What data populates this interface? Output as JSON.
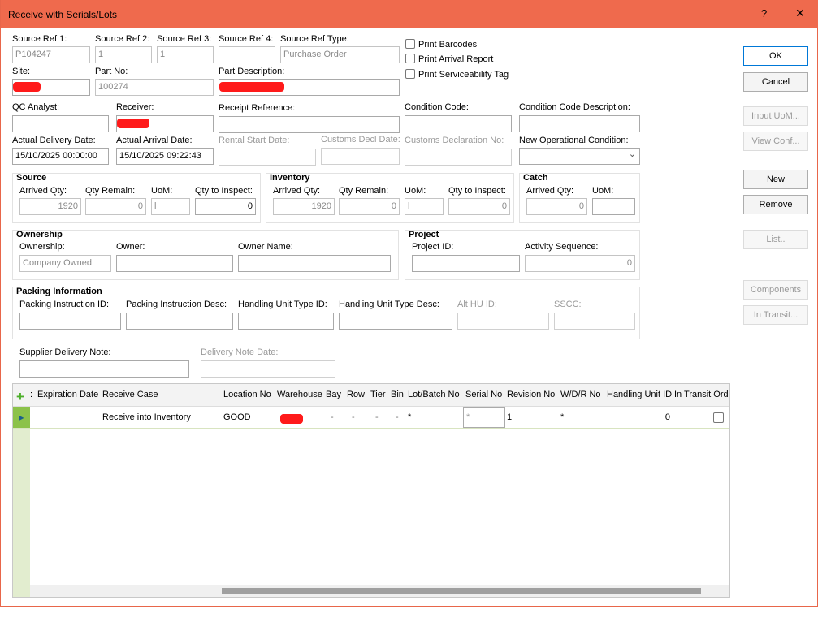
{
  "window": {
    "title": "Receive with Serials/Lots",
    "help": "?",
    "close": "✕"
  },
  "header": {
    "fields": [
      {
        "id": "src1",
        "label": "Source Ref 1:",
        "value": "P104247",
        "state": "readonly"
      },
      {
        "id": "src2",
        "label": "Source Ref 2:",
        "value": "1",
        "state": "readonly"
      },
      {
        "id": "src3",
        "label": "Source Ref 3:",
        "value": "1",
        "state": "readonly"
      },
      {
        "id": "src4",
        "label": "Source Ref 4:",
        "value": "",
        "state": "readonly"
      },
      {
        "id": "srctype",
        "label": "Source Ref Type:",
        "value": "Purchase Order",
        "state": "readonly"
      },
      {
        "id": "site",
        "label": "Site:",
        "value": "",
        "state": "redacted"
      },
      {
        "id": "partno",
        "label": "Part No:",
        "value": "100274",
        "state": "readonly"
      },
      {
        "id": "partdesc",
        "label": "Part Description:",
        "value": "",
        "state": "redacted"
      },
      {
        "id": "qc",
        "label": "QC Analyst:",
        "value": "",
        "state": "normal"
      },
      {
        "id": "receiver",
        "label": "Receiver:",
        "value": "",
        "state": "redacted"
      },
      {
        "id": "receiptref",
        "label": "Receipt Reference:",
        "value": "",
        "state": "normal"
      },
      {
        "id": "condcode",
        "label": "Condition Code:",
        "value": "",
        "state": "normal"
      },
      {
        "id": "conddesc",
        "label": "Condition Code Description:",
        "value": "",
        "state": "normal"
      },
      {
        "id": "deldate",
        "label": "Actual Delivery Date:",
        "value": "15/10/2025 00:00:00",
        "state": "normal"
      },
      {
        "id": "arrdate",
        "label": "Actual Arrival Date:",
        "value": "15/10/2025 09:22:43",
        "state": "normal"
      },
      {
        "id": "rental",
        "label": "Rental Start Date:",
        "value": "",
        "state": "disabled"
      },
      {
        "id": "customsdate",
        "label": "Customs Decl Date:",
        "value": "",
        "state": "disabled"
      },
      {
        "id": "customsno",
        "label": "Customs Declaration No:",
        "value": "",
        "state": "disabled"
      },
      {
        "id": "newopcond",
        "label": "New Operational Condition:",
        "value": "",
        "state": "dropdown"
      }
    ]
  },
  "checkboxes": [
    {
      "label": "Print Barcodes",
      "checked": false
    },
    {
      "label": "Print Arrival Report",
      "checked": false
    },
    {
      "label": "Print Serviceability Tag",
      "checked": false
    }
  ],
  "groups": [
    {
      "id": "source",
      "title": "Source",
      "fields": [
        {
          "id": "s_arr",
          "label": "Arrived Qty:",
          "value": "1920",
          "state": "readonly"
        },
        {
          "id": "s_rem",
          "label": "Qty Remain:",
          "value": "0",
          "state": "readonly"
        },
        {
          "id": "s_uom",
          "label": "UoM:",
          "value": "l",
          "state": "readonly"
        },
        {
          "id": "s_insp",
          "label": "Qty to Inspect:",
          "value": "0",
          "state": "normal"
        }
      ]
    },
    {
      "id": "inventory",
      "title": "Inventory",
      "fields": [
        {
          "id": "i_arr",
          "label": "Arrived Qty:",
          "value": "1920",
          "state": "readonly"
        },
        {
          "id": "i_rem",
          "label": "Qty Remain:",
          "value": "0",
          "state": "readonly"
        },
        {
          "id": "i_uom",
          "label": "UoM:",
          "value": "l",
          "state": "readonly"
        },
        {
          "id": "i_insp",
          "label": "Qty to Inspect:",
          "value": "0",
          "state": "readonly"
        }
      ]
    },
    {
      "id": "catch",
      "title": "Catch",
      "fields": [
        {
          "id": "c_arr",
          "label": "Arrived Qty:",
          "value": "0",
          "state": "readonly"
        },
        {
          "id": "c_uom",
          "label": "UoM:",
          "value": "",
          "state": "normal"
        }
      ]
    },
    {
      "id": "ownership",
      "title": "Ownership",
      "fields": [
        {
          "id": "o_own",
          "label": "Ownership:",
          "value": "Company Owned",
          "state": "readonly"
        },
        {
          "id": "o_owner",
          "label": "Owner:",
          "value": "",
          "state": "normal"
        },
        {
          "id": "o_name",
          "label": "Owner Name:",
          "value": "",
          "state": "normal"
        }
      ]
    },
    {
      "id": "project",
      "title": "Project",
      "fields": [
        {
          "id": "p_id",
          "label": "Project ID:",
          "value": "",
          "state": "normal"
        },
        {
          "id": "p_act",
          "label": "Activity Sequence:",
          "value": "0",
          "state": "readonly"
        }
      ]
    },
    {
      "id": "packing",
      "title": "Packing Information",
      "fields": [
        {
          "id": "k_pid",
          "label": "Packing Instruction ID:",
          "value": "",
          "state": "normal"
        },
        {
          "id": "k_pdesc",
          "label": "Packing Instruction Desc:",
          "value": "",
          "state": "normal"
        },
        {
          "id": "k_hid",
          "label": "Handling Unit Type ID:",
          "value": "",
          "state": "normal"
        },
        {
          "id": "k_hdesc",
          "label": "Handling Unit Type Desc:",
          "value": "",
          "state": "normal"
        },
        {
          "id": "k_alt",
          "label": "Alt HU ID:",
          "value": "",
          "state": "disabled"
        },
        {
          "id": "k_sscc",
          "label": "SSCC:",
          "value": "",
          "state": "disabled"
        }
      ]
    },
    {
      "id": "delivery",
      "title": "",
      "fields": [
        {
          "id": "d_note",
          "label": "Supplier Delivery Note:",
          "value": "",
          "state": "normal"
        },
        {
          "id": "d_date",
          "label": "Delivery Note Date:",
          "value": "",
          "state": "disabled"
        }
      ]
    }
  ],
  "buttons": [
    {
      "id": "ok",
      "label": "OK",
      "enabled": true
    },
    {
      "id": "cancel",
      "label": "Cancel",
      "enabled": true
    },
    {
      "id": "input-uom",
      "label": "Input UoM...",
      "enabled": false
    },
    {
      "id": "view-conf",
      "label": "View Conf...",
      "enabled": false
    },
    {
      "id": "new",
      "label": "New",
      "enabled": true
    },
    {
      "id": "remove",
      "label": "Remove",
      "enabled": true
    },
    {
      "id": "list",
      "label": "List..",
      "enabled": false
    },
    {
      "id": "components",
      "label": "Components",
      "enabled": false
    },
    {
      "id": "in-transit",
      "label": "In Transit...",
      "enabled": false
    }
  ],
  "grid": {
    "columns": [
      ":",
      "Expiration Date",
      "Receive Case",
      "Location No",
      "Warehouse",
      "Bay",
      "Row",
      "Tier",
      "Bin",
      "Lot/Batch No",
      "Serial No",
      "Revision No",
      "W/D/R No",
      "Handling Unit ID",
      "In Transit Orde"
    ],
    "rows": [
      {
        "Expiration Date": "",
        "Receive Case": "Receive into Inventory",
        "Location No": "GOOD",
        "Warehouse": "",
        "Bay": "-",
        "Row": "-",
        "Tier": "-",
        "Bin": "-",
        "Lot/Batch No": "*",
        "Serial No": "*",
        "Revision No": "1",
        "W/D/R No": "*",
        "Handling Unit ID": "0",
        "In Transit Orde": false
      }
    ]
  },
  "colors": {
    "titlebar": "#ef6a4d",
    "redaction": "#ff1a1a",
    "gutter": "#e2edcf",
    "row_marker": "#8cc24a"
  }
}
